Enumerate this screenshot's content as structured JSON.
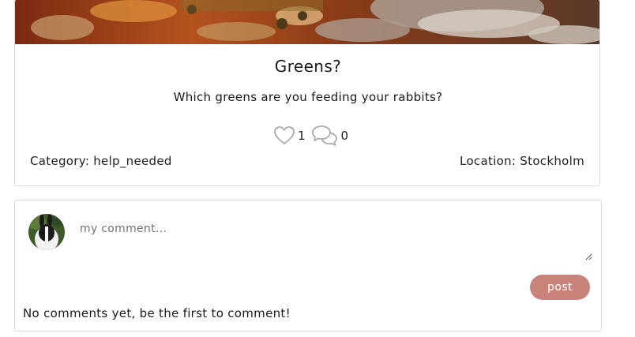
{
  "post": {
    "title": "Greens?",
    "body": "Which greens are you feeding your rabbits?",
    "likes": "1",
    "comments": "0",
    "category_label": "Category: help_needed",
    "location_label": "Location: Stockholm"
  },
  "comment_form": {
    "placeholder": "my comment...",
    "post_button_label": "post"
  },
  "comments": {
    "empty_message": "No comments yet, be the first to comment!"
  },
  "colors": {
    "accent": "#c9837a",
    "border": "#dcdcdc"
  },
  "icons": {
    "like": "heart-icon",
    "comment": "speech-bubbles-icon"
  }
}
